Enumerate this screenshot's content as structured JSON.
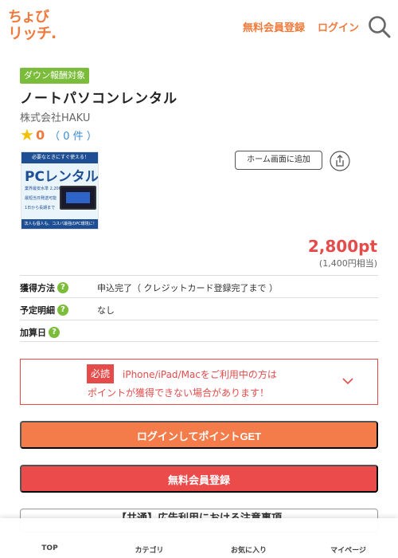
{
  "header": {
    "logo_line1": "ちょび",
    "logo_line2": "リッチ.",
    "register_label": "無料会員登録",
    "login_label": "ログイン",
    "search_icon": "search-icon"
  },
  "offer": {
    "badge": "ダウン報酬対象",
    "title": "ノートパソコンレンタル",
    "company": "株式会社HAKU",
    "rating_score": "0",
    "rating_count": "（ 0 件 ）",
    "thumb": {
      "top": "必要なときにすぐ使える！",
      "big": "PCレンタル",
      "line1": "業界最安水準 2,200円/月〜",
      "line2": "最短当日発送可能",
      "line3": "1日から長期まで",
      "bottom": "法人も個人も、コスパ最強のPC環境に！"
    },
    "home_button": "ホーム画面に追加",
    "points": "2,800pt",
    "yen": "(1,400円相当)"
  },
  "info": [
    {
      "label": "獲得方法",
      "help": "?",
      "value": "申込完了（ クレジットカード登録完了まで ）"
    },
    {
      "label": "予定明細",
      "help": "?",
      "value": "なし"
    },
    {
      "label": "加算日",
      "help": "?",
      "value": ""
    }
  ],
  "notice": {
    "must": "必読",
    "line1": "iPhone/iPad/Macをご利用中の方は",
    "line2": "ポイントが獲得できない場合があります！"
  },
  "buttons": {
    "login_get": "ログインしてポイントGET",
    "register": "無料会員登録"
  },
  "caution": "【共通】広告利用における注意事項",
  "bottom_nav": [
    {
      "label": "TOP"
    },
    {
      "label": "カテゴリ"
    },
    {
      "label": "お気に入り"
    },
    {
      "label": "マイページ"
    }
  ],
  "colors": {
    "brand_orange": "#f07a3c",
    "badge_green": "#7bbd3b",
    "alert_red": "#e54b4b"
  }
}
